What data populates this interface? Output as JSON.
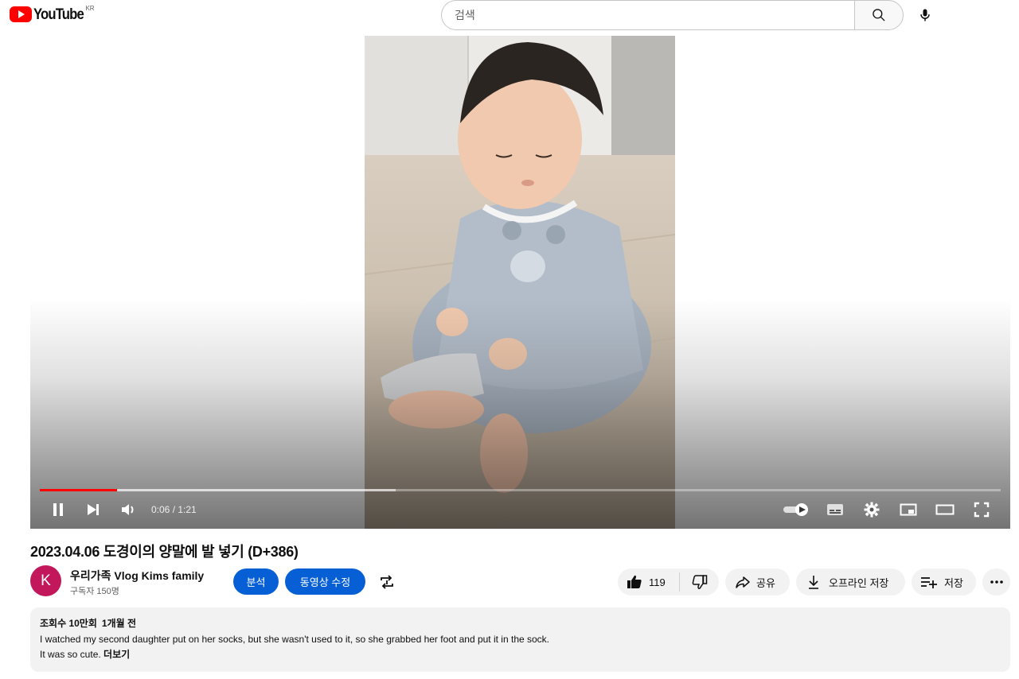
{
  "header": {
    "logo_text": "YouTube",
    "region": "KR",
    "search_placeholder": "검색",
    "icons": {
      "search": "search-icon",
      "mic": "mic-icon"
    }
  },
  "player": {
    "current_time": "0:06",
    "duration": "1:21",
    "time_display": "0:06 / 1:21",
    "played_fraction": 0.08,
    "buffered_fraction": 0.37,
    "state": "playing",
    "autoplay_enabled": true
  },
  "video": {
    "title": "2023.04.06 도경이의 양말에 발 넣기 (D+386)"
  },
  "channel": {
    "avatar_letter": "K",
    "avatar_color": "#c2185b",
    "name": "우리가족 Vlog Kims family",
    "subscribers": "구독자 150명"
  },
  "actions": {
    "analytics": "분석",
    "edit_video": "동영상 수정",
    "like_count": "119",
    "share": "공유",
    "download": "오프라인 저장",
    "save": "저장"
  },
  "description": {
    "views": "조회수 10만회",
    "age": "1개월 전",
    "line1": "I watched my second daughter put on her socks, but she wasn't used to it, so she grabbed her foot and put it in the sock.",
    "line2": "It was so cute.",
    "more": "더보기"
  },
  "colors": {
    "brand_red": "#ff0000",
    "accent_blue": "#065fd4",
    "pill_bg": "#f2f2f2"
  }
}
